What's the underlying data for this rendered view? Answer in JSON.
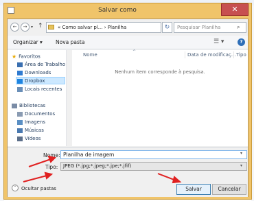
{
  "dialog": {
    "title": "Salvar como",
    "close_glyph": "✕"
  },
  "nav": {
    "back_glyph": "←",
    "forward_glyph": "→",
    "up_glyph": "↑",
    "address": "« Como salvar pl... › Planilha",
    "refresh_glyph": "↻",
    "search_placeholder": "Pesquisar Planilha"
  },
  "toolbar": {
    "organize_label": "Organizar ▾",
    "new_folder_label": "Nova pasta",
    "view_glyph": "☰ ▾",
    "help_glyph": "?"
  },
  "sidebar": {
    "favorites": {
      "label": "Favoritos",
      "items": [
        {
          "label": "Área de Trabalho",
          "icon": "desktop-icon",
          "color": "#3a6fb0"
        },
        {
          "label": "Downloads",
          "icon": "downloads-icon",
          "color": "#2f7bd1"
        },
        {
          "label": "Dropbox",
          "icon": "dropbox-icon",
          "color": "#1e84e0"
        },
        {
          "label": "Locais recentes",
          "icon": "recent-places-icon",
          "color": "#6a8fb8"
        }
      ]
    },
    "libraries": {
      "label": "Bibliotecas",
      "items": [
        {
          "label": "Documentos",
          "icon": "documents-icon",
          "color": "#8a9bb2"
        },
        {
          "label": "Imagens",
          "icon": "pictures-icon",
          "color": "#5a8fc4"
        },
        {
          "label": "Músicas",
          "icon": "music-icon",
          "color": "#4a79b0"
        },
        {
          "label": "Vídeos",
          "icon": "videos-icon",
          "color": "#5c6f8a"
        }
      ]
    }
  },
  "filelist": {
    "columns": [
      "Nome",
      "Data de modificaç...",
      "Tipo"
    ],
    "empty_message": "Nenhum item corresponde à pesquisa."
  },
  "form": {
    "name_label": "Nome:",
    "name_value": "Planilha de imagem",
    "type_label": "Tipo:",
    "type_value": "JPEG (*.jpg;*.jpeg;*.jpe;*.jfif)",
    "hide_folders_label": "Ocultar pastas",
    "save_label": "Salvar",
    "cancel_label": "Cancelar"
  },
  "colors": {
    "dialog_frame": "#f0c46a",
    "close_button": "#c75050",
    "annotation_arrow": "#e02020"
  }
}
